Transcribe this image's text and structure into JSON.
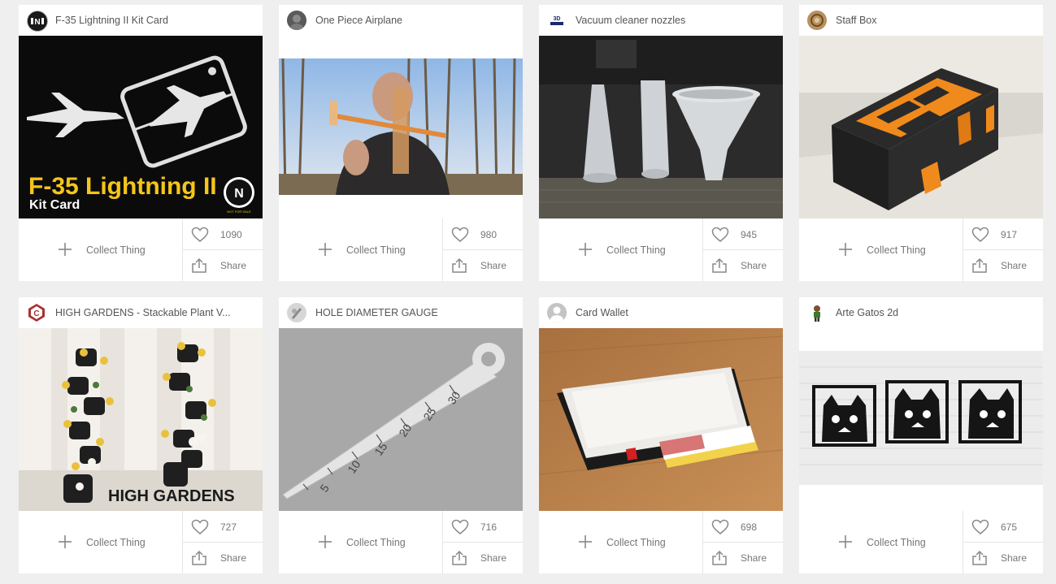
{
  "ui": {
    "collect_label": "Collect Thing",
    "share_label": "Share"
  },
  "cards": [
    {
      "title": "F-35 Lightning II Kit Card",
      "likes": "1090",
      "thumb_text": [
        "F-35 Lightning II",
        "Kit Card"
      ],
      "badge": "N",
      "badge_note": "NOT FOR SALE"
    },
    {
      "title": "One Piece Airplane",
      "likes": "980"
    },
    {
      "title": "Vacuum cleaner nozzles",
      "likes": "945"
    },
    {
      "title": "Staff Box",
      "likes": "917"
    },
    {
      "title": "HIGH GARDENS - Stackable Plant V...",
      "likes": "727",
      "thumb_text": [
        "HIGH GARDENS"
      ]
    },
    {
      "title": "HOLE DIAMETER GAUGE",
      "likes": "716",
      "thumb_text": [
        "30",
        "25",
        "20",
        "15",
        "10",
        "5"
      ]
    },
    {
      "title": "Card Wallet",
      "likes": "698"
    },
    {
      "title": "Arte Gatos 2d",
      "likes": "675"
    }
  ],
  "colors": {
    "page_bg": "#efefef",
    "card_bg": "#ffffff",
    "text_muted": "#777777",
    "accent_yellow": "#f5c518",
    "accent_orange": "#f08a1c"
  },
  "icons": [
    "plus-icon",
    "heart-icon",
    "share-icon"
  ]
}
